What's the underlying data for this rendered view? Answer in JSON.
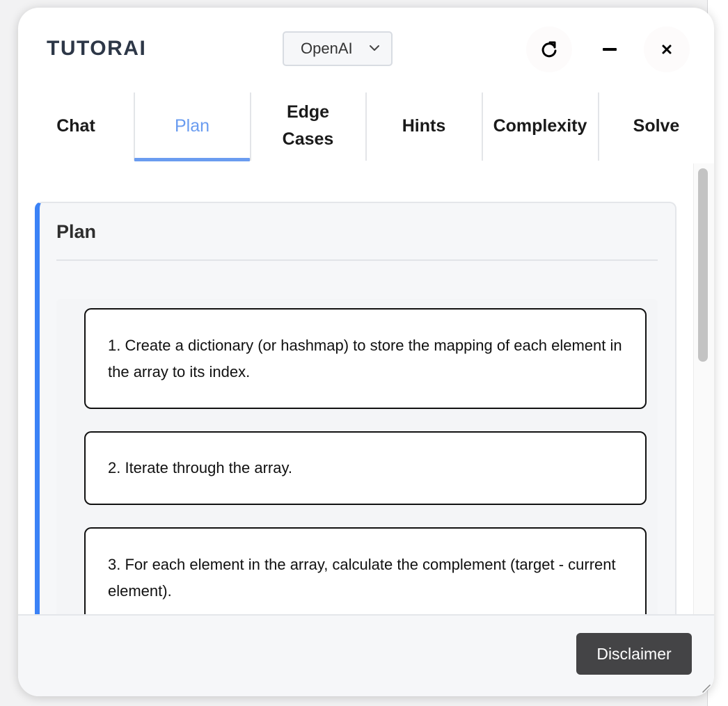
{
  "app": {
    "brand": "TUTORAI",
    "provider_select": {
      "value": "OpenAI",
      "options": [
        "OpenAI"
      ]
    }
  },
  "toolbar": {
    "refresh_icon": "refresh-icon",
    "minimize_icon": "minimize-icon",
    "close_icon": "close-icon"
  },
  "tabs": [
    {
      "label": "Chat",
      "active": false
    },
    {
      "label": "Plan",
      "active": true
    },
    {
      "label": "Edge Cases",
      "active": false
    },
    {
      "label": "Hints",
      "active": false
    },
    {
      "label": "Complexity",
      "active": false
    },
    {
      "label": "Solve",
      "active": false
    }
  ],
  "plan": {
    "title": "Plan",
    "steps": [
      "1. Create a dictionary (or hashmap) to store the mapping of each element in the array to its index.",
      "2. Iterate through the array.",
      "3. For each element in the array, calculate the complement (target - current element)."
    ]
  },
  "footer": {
    "disclaimer_label": "Disclaimer"
  },
  "colors": {
    "accent": "#3b82f6",
    "active_tab": "#6a9cf0",
    "brand_text": "#2d3747",
    "disclaimer_bg": "#444446"
  }
}
